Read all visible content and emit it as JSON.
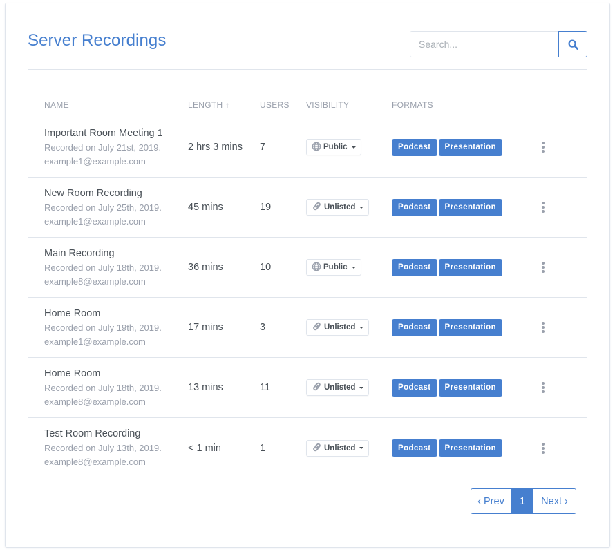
{
  "page": {
    "title": "Server Recordings"
  },
  "search": {
    "placeholder": "Search...",
    "value": "",
    "button_icon": "search-icon"
  },
  "table": {
    "columns": [
      "Name",
      "Length ↑",
      "Users",
      "Visibility",
      "Formats"
    ],
    "rows": [
      {
        "name": "Important Room Meeting 1",
        "recorded": "Recorded on July 21st, 2019.",
        "owner": "example1@example.com",
        "length": "2 hrs 3 mins",
        "users": "7",
        "visibility": "Public",
        "visibility_icon": "globe-icon",
        "formats": [
          "Podcast",
          "Presentation"
        ]
      },
      {
        "name": "New Room Recording",
        "recorded": "Recorded on July 25th, 2019.",
        "owner": "example1@example.com",
        "length": "45 mins",
        "users": "19",
        "visibility": "Unlisted",
        "visibility_icon": "link-icon",
        "formats": [
          "Podcast",
          "Presentation"
        ]
      },
      {
        "name": "Main Recording",
        "recorded": "Recorded on July 18th, 2019.",
        "owner": "example8@example.com",
        "length": "36 mins",
        "users": "10",
        "visibility": "Public",
        "visibility_icon": "globe-icon",
        "formats": [
          "Podcast",
          "Presentation"
        ]
      },
      {
        "name": "Home Room",
        "recorded": "Recorded on July 19th, 2019.",
        "owner": "example1@example.com",
        "length": "17 mins",
        "users": "3",
        "visibility": "Unlisted",
        "visibility_icon": "link-icon",
        "formats": [
          "Podcast",
          "Presentation"
        ]
      },
      {
        "name": "Home Room",
        "recorded": "Recorded on July 18th, 2019.",
        "owner": "example8@example.com",
        "length": "13 mins",
        "users": "11",
        "visibility": "Unlisted",
        "visibility_icon": "link-icon",
        "formats": [
          "Podcast",
          "Presentation"
        ]
      },
      {
        "name": "Test Room Recording",
        "recorded": "Recorded on July 13th, 2019.",
        "owner": "example8@example.com",
        "length": "< 1 min",
        "users": "1",
        "visibility": "Unlisted",
        "visibility_icon": "link-icon",
        "formats": [
          "Podcast",
          "Presentation"
        ]
      }
    ]
  },
  "pagination": {
    "prev_label": "‹ Prev",
    "current_page": "1",
    "next_label": "Next ›"
  },
  "colors": {
    "accent": "#467fcf",
    "muted_text": "#9aa0ac",
    "body_text": "#495057",
    "border": "#e0e5ec"
  }
}
